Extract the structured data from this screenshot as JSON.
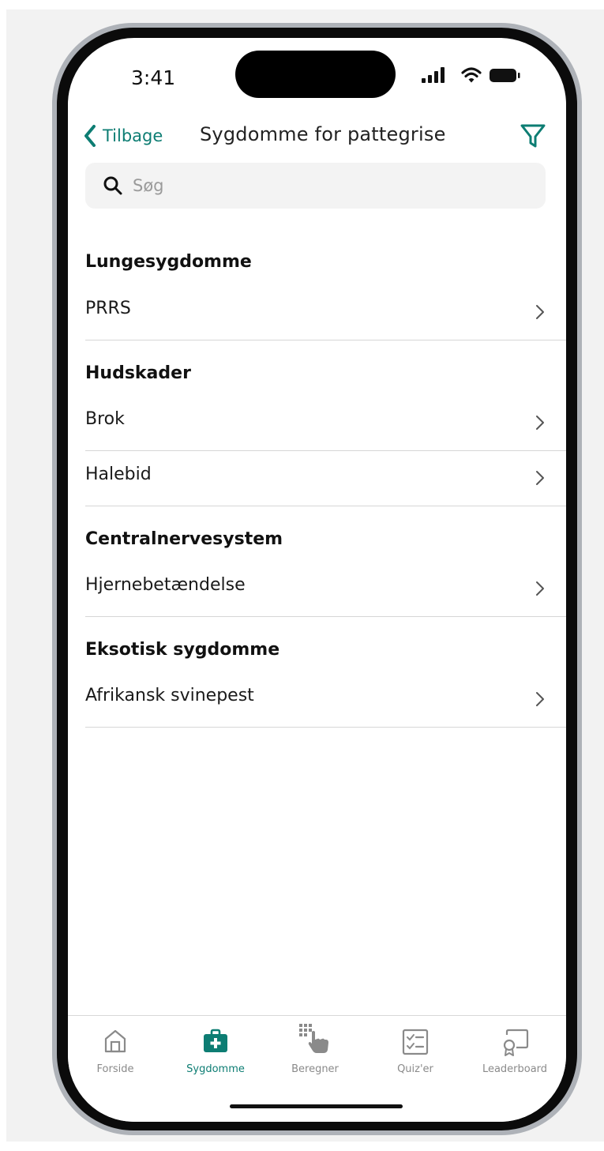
{
  "status_bar": {
    "time": "3:41"
  },
  "nav": {
    "back_label": "Tilbage",
    "title": "Sygdomme for pattegrise"
  },
  "search": {
    "placeholder": "Søg"
  },
  "sections": [
    {
      "header": "Lungesygdomme",
      "items": [
        {
          "label": "PRRS"
        }
      ]
    },
    {
      "header": "Hudskader",
      "items": [
        {
          "label": "Brok"
        },
        {
          "label": "Halebid"
        }
      ]
    },
    {
      "header": "Centralnervesystem",
      "items": [
        {
          "label": "Hjernebetændelse"
        }
      ]
    },
    {
      "header": "Eksotisk sygdomme",
      "items": [
        {
          "label": "Afrikansk svinepest"
        }
      ]
    }
  ],
  "tabs": [
    {
      "label": "Forside",
      "icon": "home-icon",
      "active": false
    },
    {
      "label": "Sygdomme",
      "icon": "medical-kit-icon",
      "active": true
    },
    {
      "label": "Beregner",
      "icon": "keypad-tap-icon",
      "active": false
    },
    {
      "label": "Quiz'er",
      "icon": "checklist-icon",
      "active": false
    },
    {
      "label": "Leaderboard",
      "icon": "certificate-icon",
      "active": false
    }
  ],
  "colors": {
    "accent": "#0d7d73",
    "tab_inactive": "#8a8a8a",
    "search_bg": "#f3f3f3"
  }
}
